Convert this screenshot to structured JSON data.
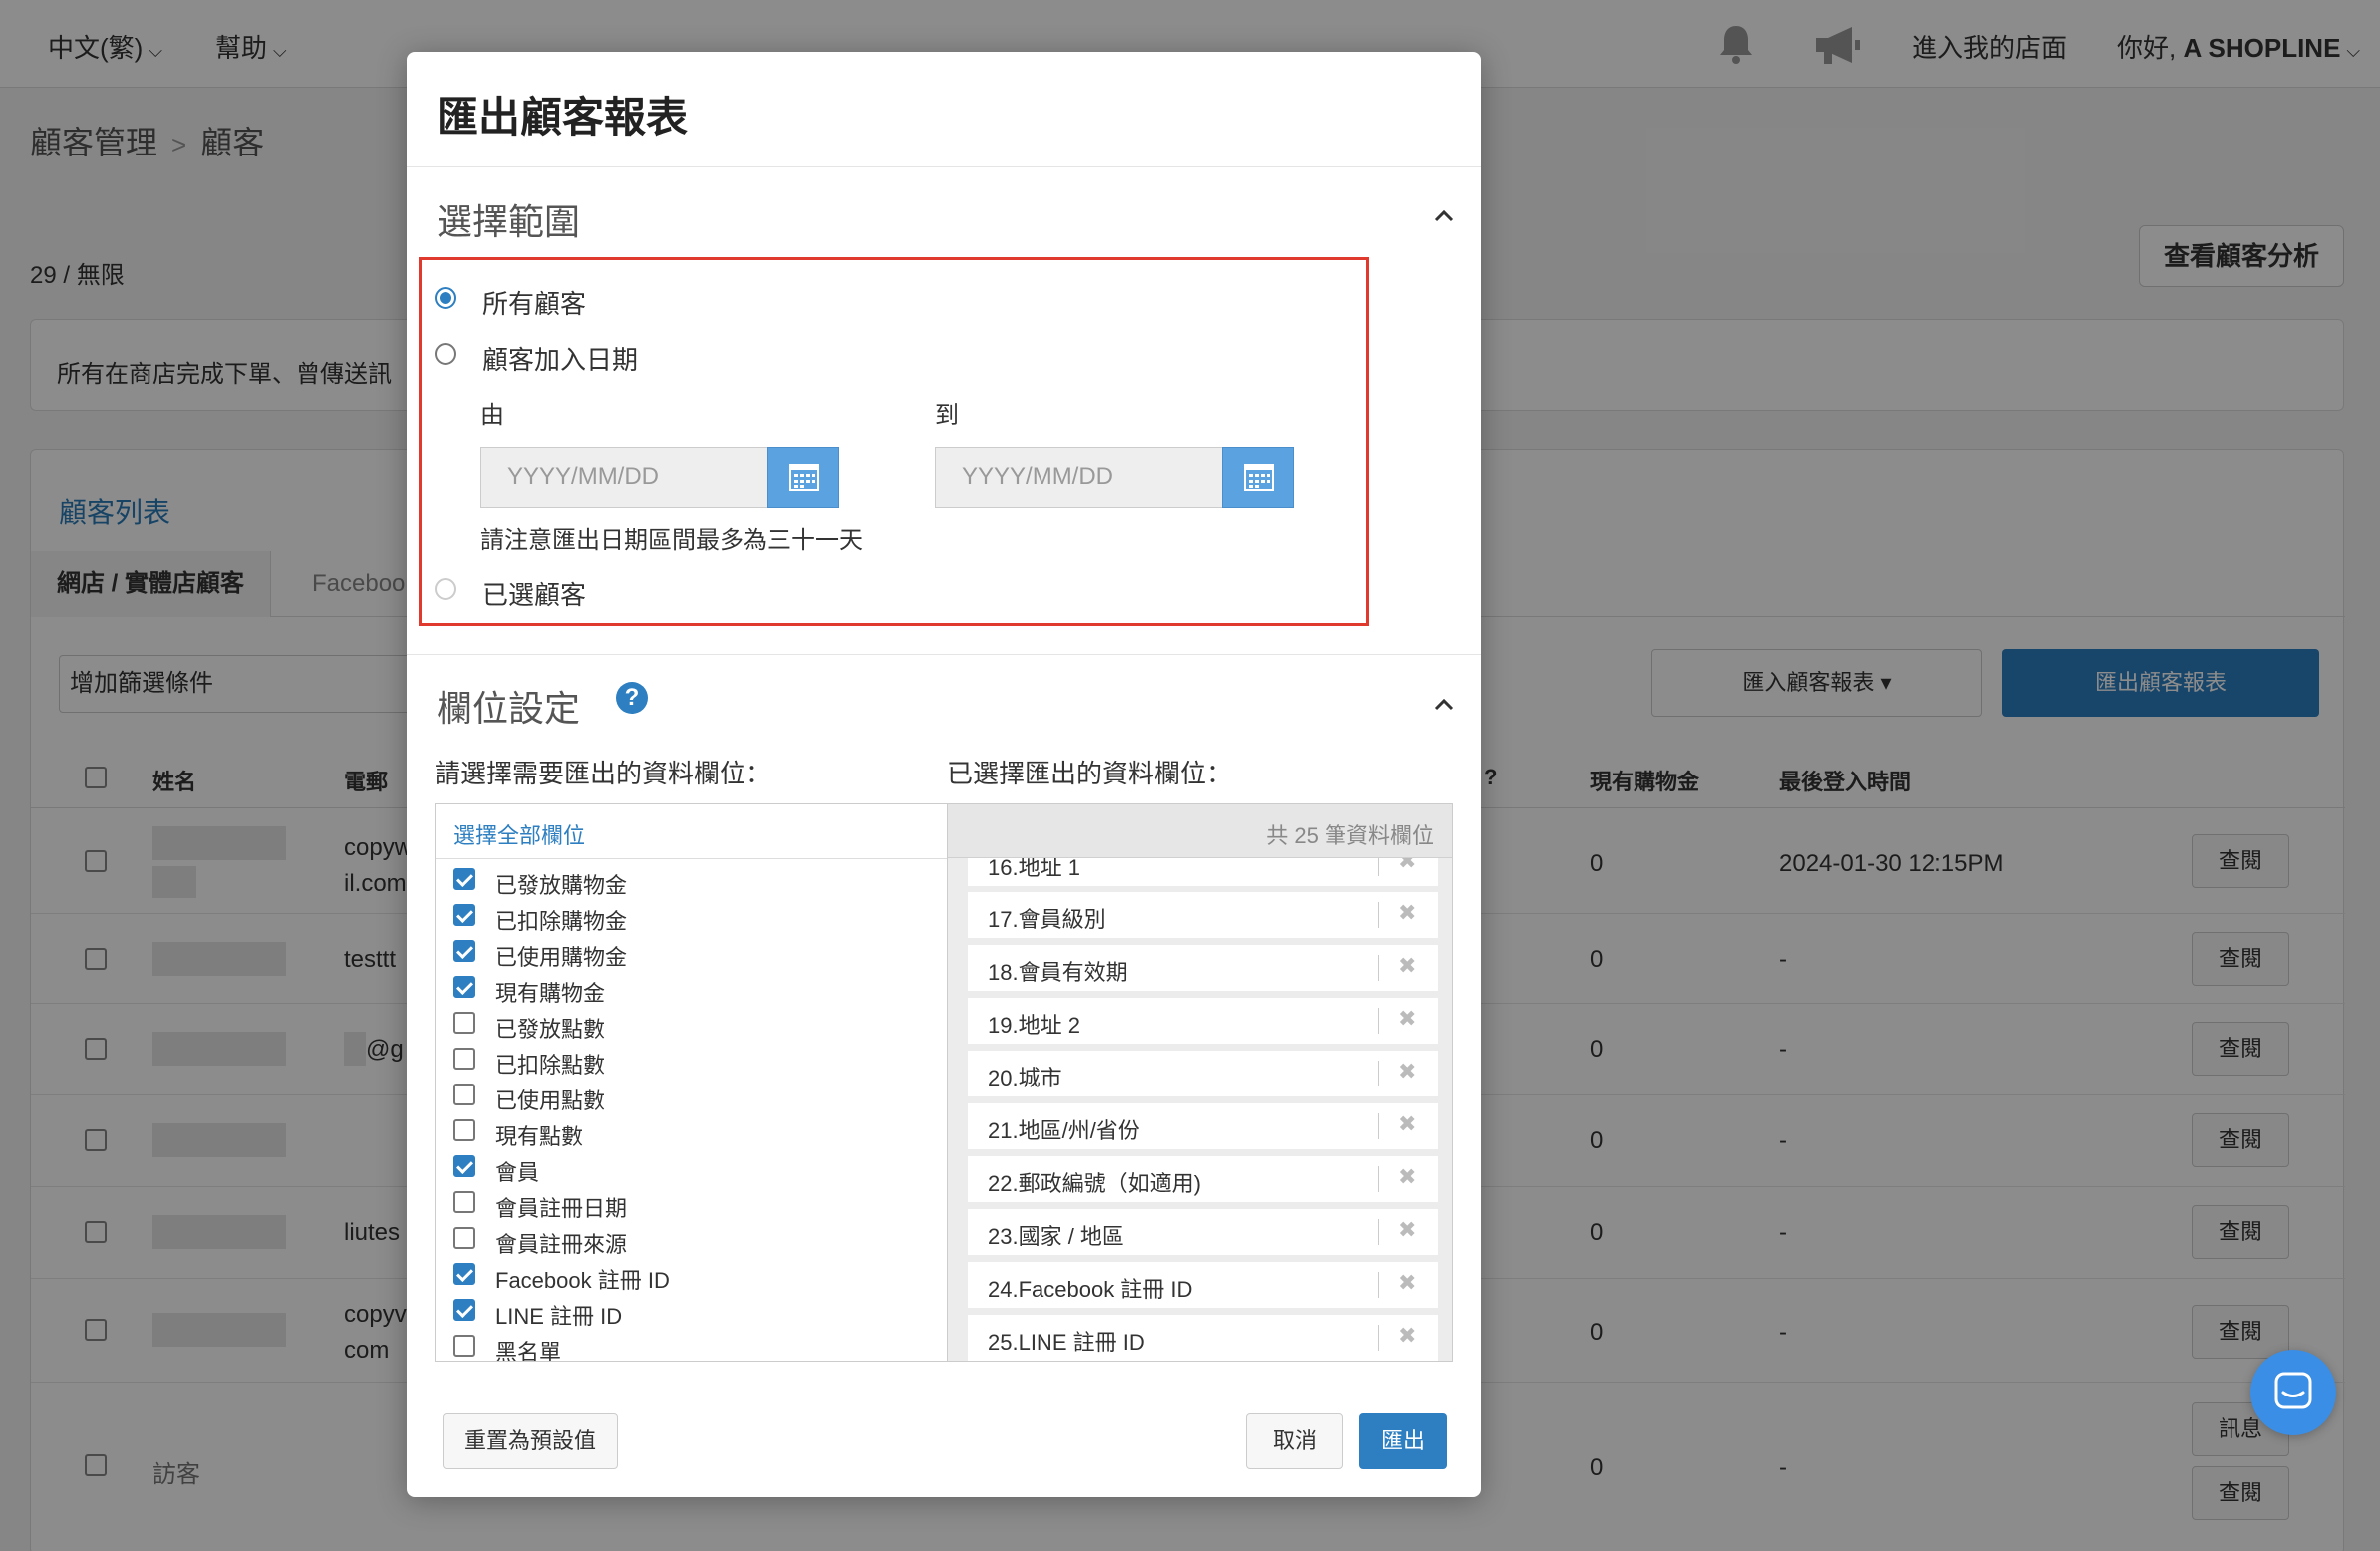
{
  "topbar": {
    "language": "中文(繁)",
    "help": "幫助",
    "store_link": "進入我的店面",
    "greeting_prefix": "你好,",
    "greeting_name": "A SHOPLINE"
  },
  "breadcrumb": {
    "parent": "顧客管理",
    "current": "顧客"
  },
  "count": "29 / 無限",
  "analysis_button": "查看顧客分析",
  "notice": "所有在商店完成下單、曾傳送訊",
  "panel": {
    "title": "顧客列表",
    "tabs": [
      "網店 / 實體店顧客",
      "Faceboo"
    ],
    "filter_placeholder": "增加篩選條件",
    "import_button": "匯入顧客報表",
    "export_button": "匯出顧客報表",
    "columns": [
      "姓名",
      "電郵",
      "?",
      "現有購物金",
      "最後登入時間"
    ],
    "rows": [
      {
        "email": "copyw\nil.com",
        "credit": "0",
        "last_login": "2024-01-30 12:15PM",
        "action": "查閱"
      },
      {
        "email": "testtt",
        "credit": "0",
        "last_login": "-",
        "action": "查閱"
      },
      {
        "email": "@g",
        "credit": "0",
        "last_login": "-",
        "action": "查閱"
      },
      {
        "email": "",
        "credit": "0",
        "last_login": "-",
        "action": "查閱"
      },
      {
        "email": "liutes",
        "credit": "0",
        "last_login": "-",
        "action": "查閱"
      },
      {
        "email": "copyv\ncom",
        "credit": "0",
        "last_login": "-",
        "action": "查閱"
      },
      {
        "name": "訪客",
        "credit": "0",
        "last_login": "-",
        "action": "查閱",
        "action2": "訊息"
      }
    ]
  },
  "modal": {
    "title": "匯出顧客報表",
    "range_section": {
      "title": "選擇範圍",
      "options": [
        "所有顧客",
        "顧客加入日期",
        "已選顧客"
      ],
      "selected": "所有顧客",
      "from_label": "由",
      "to_label": "到",
      "date_placeholder": "YYYY/MM/DD",
      "note": "請注意匯出日期區間最多為三十一天"
    },
    "fields_section": {
      "title": "欄位設定",
      "left_title": "請選擇需要匯出的資料欄位：",
      "right_title": "已選擇匯出的資料欄位：",
      "select_all": "選擇全部欄位",
      "total_label": "共 25 筆資料欄位",
      "available": [
        {
          "label": "已發放購物金",
          "checked": true
        },
        {
          "label": "已扣除購物金",
          "checked": true
        },
        {
          "label": "已使用購物金",
          "checked": true
        },
        {
          "label": "現有購物金",
          "checked": true
        },
        {
          "label": "已發放點數",
          "checked": false
        },
        {
          "label": "已扣除點數",
          "checked": false
        },
        {
          "label": "已使用點數",
          "checked": false
        },
        {
          "label": "現有點數",
          "checked": false
        },
        {
          "label": "會員",
          "checked": true
        },
        {
          "label": "會員註冊日期",
          "checked": false
        },
        {
          "label": "會員註冊來源",
          "checked": false
        },
        {
          "label": "Facebook 註冊 ID",
          "checked": true
        },
        {
          "label": "LINE 註冊 ID",
          "checked": true
        },
        {
          "label": "黑名單",
          "checked": false
        }
      ],
      "selected": [
        "16.地址 1",
        "17.會員級別",
        "18.會員有效期",
        "19.地址 2",
        "20.城市",
        "21.地區/州/省份",
        "22.郵政編號（如適用)",
        "23.國家 / 地區",
        "24.Facebook 註冊 ID",
        "25.LINE 註冊 ID"
      ]
    },
    "reset_button": "重置為預設值",
    "cancel_button": "取消",
    "submit_button": "匯出"
  },
  "colors": {
    "accent": "#2d7fc1",
    "highlight_box": "#e03a2e"
  }
}
